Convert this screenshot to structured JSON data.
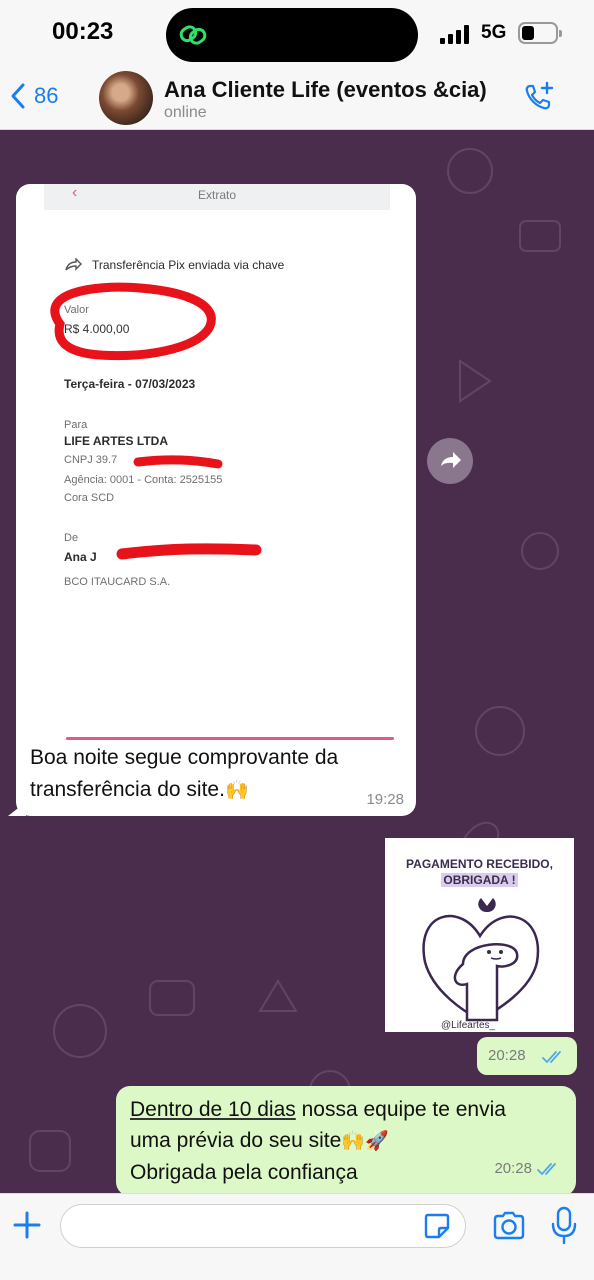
{
  "status_bar": {
    "time": "00:23",
    "network": "5G",
    "signal_bars": 4,
    "battery_level": 0.3
  },
  "header": {
    "back_count": "86",
    "contact_name": "Ana Cliente Life (eventos &cia)",
    "contact_status": "online",
    "icons": [
      "back-chevron-icon",
      "call-add-icon"
    ]
  },
  "messages": {
    "incoming": {
      "receipt": {
        "header_title": "Extrato",
        "pix_label": "Transferência Pix enviada via chave",
        "valor_label": "Valor",
        "valor_value": "R$ 4.000,00",
        "data_value": "Terça-feira - 07/03/2023",
        "para_label": "Para",
        "para_name": "LIFE ARTES LTDA",
        "cnpj": "CNPJ 39.7",
        "agencia": "Agência: 0001 - Conta: 2525155",
        "bank_to": "Cora SCD",
        "de_label": "De",
        "de_name": "Ana J",
        "bank_from": "BCO ITAUCARD S.A."
      },
      "text": "Boa noite segue comprovante da transferência do site.",
      "emoji": "🙌",
      "time": "19:28"
    },
    "image": {
      "title_line1": "PAGAMENTO RECEBIDO,",
      "title_line2": "OBRIGADA !",
      "handle": "@Lifeartes_",
      "time": "20:28"
    },
    "outgoing": {
      "underlined": "Dentro de 10 dias",
      "line1_rest": " nossa equipe te envia",
      "line2": "uma prévia do seu site",
      "line2_emoji": "🙌🚀",
      "line3": "Obrigada pela confiança",
      "time": "20:28"
    }
  },
  "input_bar": {
    "placeholder": "",
    "icons": [
      "plus-icon",
      "sticker-icon",
      "camera-icon",
      "microphone-icon"
    ]
  },
  "colors": {
    "chat_background": "#4a2c4d",
    "outgoing_bubble": "#dcf8c6",
    "incoming_bubble": "#ffffff",
    "accent": "#1a7df0",
    "read_ticks": "#4fa8e6",
    "annotation_red": "#e8121b"
  }
}
